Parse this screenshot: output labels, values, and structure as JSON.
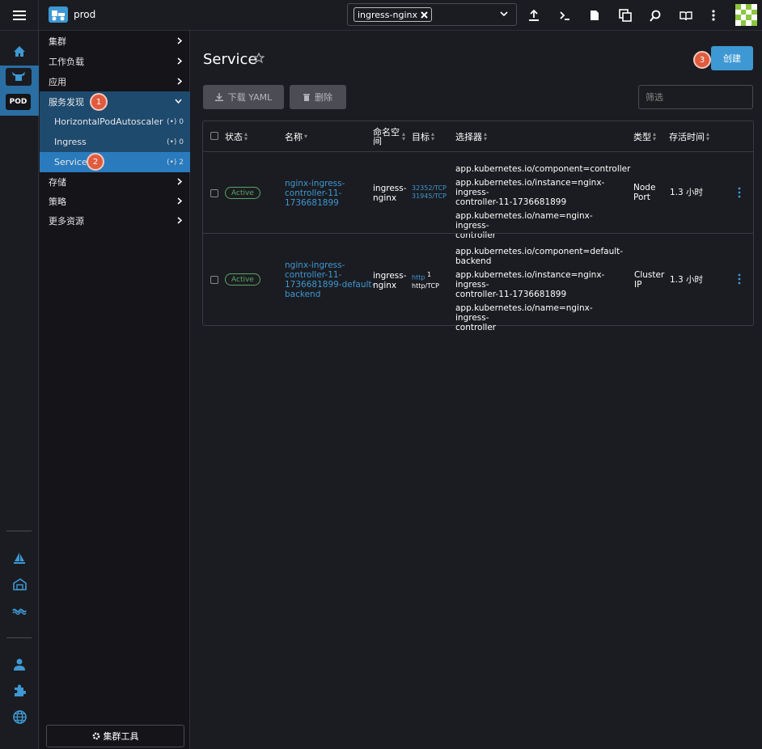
{
  "topbar": {
    "cluster_name": "prod",
    "namespace_tag": "ingress-nginx"
  },
  "sidenav": {
    "groups": [
      {
        "label": "集群"
      },
      {
        "label": "工作负载"
      },
      {
        "label": "应用"
      },
      {
        "label": "服务发现"
      },
      {
        "label": "存储"
      },
      {
        "label": "策略"
      },
      {
        "label": "更多资源"
      }
    ],
    "children": [
      {
        "label": "HorizontalPodAutoscaler",
        "count": "0"
      },
      {
        "label": "Ingress",
        "count": "0"
      },
      {
        "label": "Service",
        "count": "2"
      }
    ],
    "cluster_tools": "集群工具",
    "rail_pod_label": "POD"
  },
  "badges": {
    "b1": "1",
    "b2": "2",
    "b3": "3"
  },
  "main": {
    "title": "Service",
    "create_label": "创建",
    "download_label": "下载 YAML",
    "delete_label": "删除",
    "filter_placeholder": "筛选"
  },
  "table": {
    "headers": {
      "status": "状态",
      "name": "名称",
      "namespace": "命名空间",
      "target": "目标",
      "selector": "选择器",
      "type": "类型",
      "age": "存活时间"
    },
    "rows": [
      {
        "status": "Active",
        "name_lines": [
          "nginx-ingress-",
          "controller-11-",
          "1736681899"
        ],
        "namespace_lines": [
          "ingress-",
          "nginx"
        ],
        "targets": [
          "32352/TCP",
          "31945/TCP"
        ],
        "selectors": [
          [
            "app.kubernetes.io/component=controller"
          ],
          [
            "app.kubernetes.io/instance=nginx-ingress-",
            "controller-11-1736681899"
          ],
          [
            "app.kubernetes.io/name=nginx-ingress-",
            "controller"
          ]
        ],
        "type_lines": [
          "Node",
          "Port"
        ],
        "age": "1.3 小时"
      },
      {
        "status": "Active",
        "name_lines": [
          "nginx-ingress-",
          "controller-11-",
          "1736681899-default-",
          "backend"
        ],
        "namespace_lines": [
          "ingress-",
          "nginx"
        ],
        "target_link": "http",
        "target_sup": "1",
        "target_port": "http/TCP",
        "selectors": [
          [
            "app.kubernetes.io/component=default-",
            "backend"
          ],
          [
            "app.kubernetes.io/instance=nginx-ingress-",
            "controller-11-1736681899"
          ],
          [
            "app.kubernetes.io/name=nginx-ingress-",
            "controller"
          ]
        ],
        "type_lines": [
          "Cluster",
          "IP"
        ],
        "age": "1.3 小时"
      }
    ]
  },
  "colors": {
    "accent": "#3d98d3",
    "badge": "#e15b3f",
    "active": "#5aa564"
  }
}
